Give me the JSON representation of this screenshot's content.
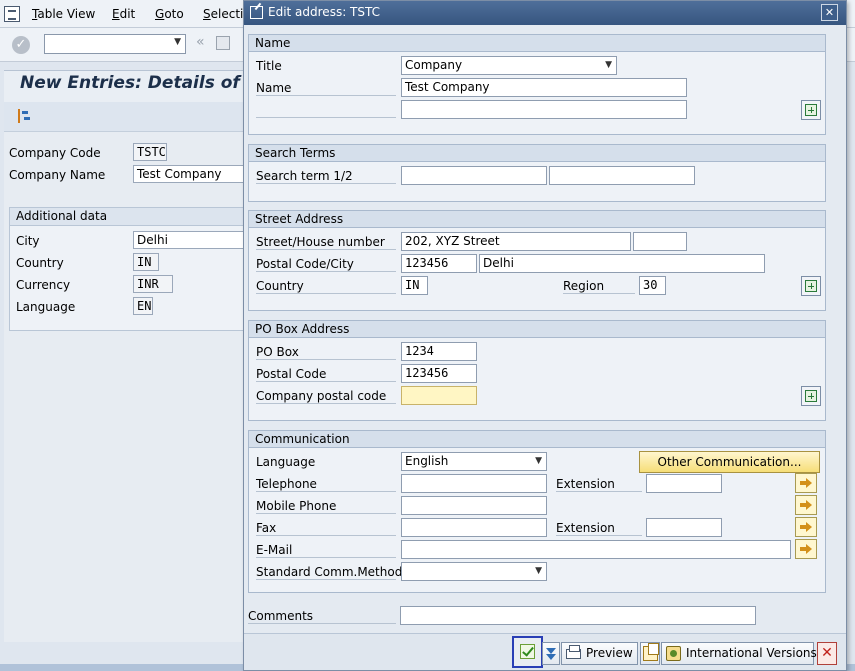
{
  "background": {
    "menu": [
      "Table View",
      "Edit",
      "Goto",
      "Selectio"
    ],
    "page_title": "New Entries: Details of Ad",
    "company_code_label": "Company Code",
    "company_code_value": "TSTC",
    "company_name_label": "Company Name",
    "company_name_value": "Test Company",
    "additional_data": {
      "title": "Additional data",
      "city_label": "City",
      "city_value": "Delhi",
      "country_label": "Country",
      "country_value": "IN",
      "currency_label": "Currency",
      "currency_value": "INR",
      "language_label": "Language",
      "language_value": "EN"
    }
  },
  "dialog": {
    "title": "Edit address:  TSTC",
    "close_label": "✕",
    "name_group": {
      "title": "Name",
      "title_label": "Title",
      "title_value": "Company",
      "name_label": "Name",
      "name_value": "Test Company",
      "name2_value": ""
    },
    "search_group": {
      "title": "Search Terms",
      "term_label": "Search term 1/2",
      "term1_value": "",
      "term2_value": ""
    },
    "street_group": {
      "title": "Street Address",
      "street_label": "Street/House number",
      "street_value": "202, XYZ Street",
      "house_value": "",
      "postal_city_label": "Postal Code/City",
      "postal_value": "123456",
      "city_value": "Delhi",
      "country_label": "Country",
      "country_value": "IN",
      "region_label": "Region",
      "region_value": "30"
    },
    "pobox_group": {
      "title": "PO Box Address",
      "pobox_label": "PO Box",
      "pobox_value": "1234",
      "postal_label": "Postal Code",
      "postal_value": "123456",
      "company_postal_label": "Company postal code",
      "company_postal_value": ""
    },
    "comm_group": {
      "title": "Communication",
      "language_label": "Language",
      "language_value": "English",
      "other_comm_label": "Other Communication...",
      "telephone_label": "Telephone",
      "telephone_value": "",
      "extension_label": "Extension",
      "tel_ext_value": "",
      "mobile_label": "Mobile Phone",
      "mobile_value": "",
      "fax_label": "Fax",
      "fax_value": "",
      "fax_ext_value": "",
      "email_label": "E-Mail",
      "email_value": "",
      "std_comm_label": "Standard Comm.Method",
      "std_comm_value": ""
    },
    "comments_label": "Comments",
    "comments_value": "",
    "footer": {
      "preview_label": "Preview",
      "intl_label": "International Versions",
      "cancel_label": "✕"
    }
  }
}
